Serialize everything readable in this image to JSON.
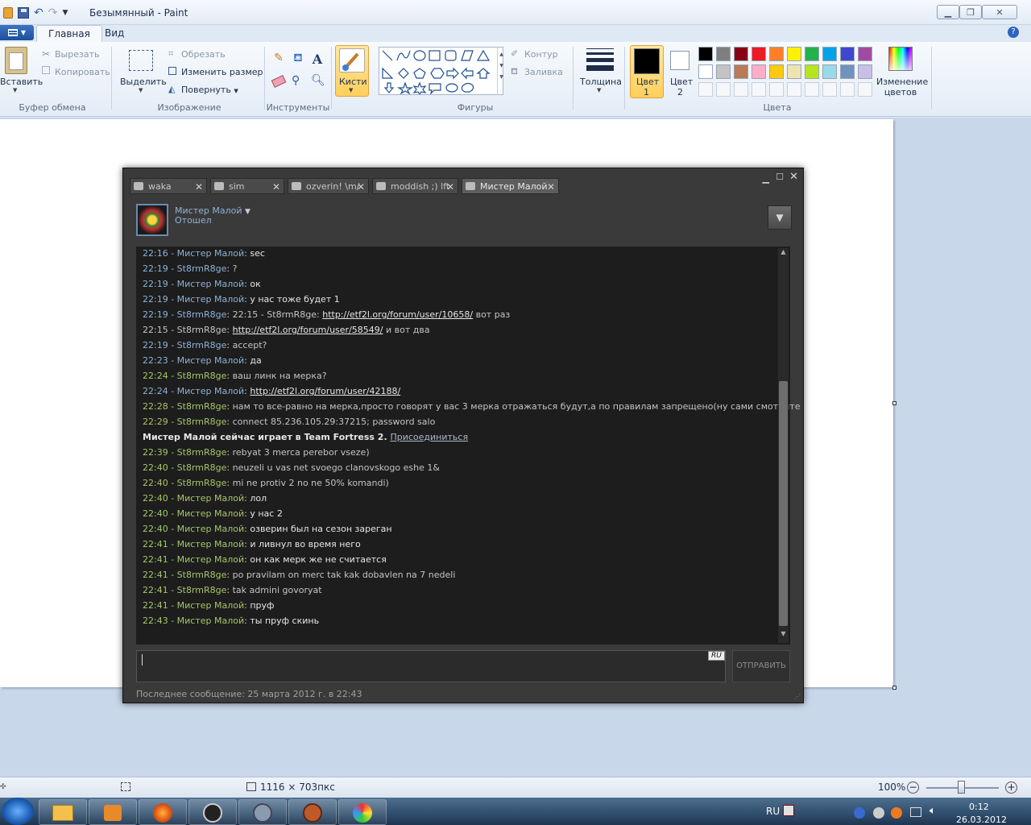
{
  "window": {
    "title": "Безымянный - Paint"
  },
  "ribbon": {
    "tabs": [
      "Главная",
      "Вид"
    ],
    "clipboard": {
      "paste": "Вставить",
      "cut": "Вырезать",
      "copy": "Копировать",
      "group": "Буфер обмена"
    },
    "image": {
      "select": "Выделить",
      "crop": "Обрезать",
      "resize": "Изменить размер",
      "rotate": "Повернуть",
      "group": "Изображение"
    },
    "tools": {
      "group": "Инструменты"
    },
    "brushes": {
      "label": "Кисти"
    },
    "shapes": {
      "outline": "Контур",
      "fill": "Заливка",
      "group": "Фигуры"
    },
    "size": {
      "label": "Толщина"
    },
    "color1": {
      "label1": "Цвет",
      "label2": "1"
    },
    "color2": {
      "label1": "Цвет",
      "label2": "2"
    },
    "colors": {
      "group": "Цвета",
      "edit1": "Изменение",
      "edit2": "цветов",
      "row1": [
        "#000000",
        "#7f7f7f",
        "#880015",
        "#ed1c24",
        "#ff7f27",
        "#fff200",
        "#22b14c",
        "#00a2e8",
        "#3f48cc",
        "#a349a4"
      ],
      "row2": [
        "#ffffff",
        "#c3c3c3",
        "#b97a57",
        "#ffaec9",
        "#ffc90e",
        "#efe4b0",
        "#b5e61d",
        "#99d9ea",
        "#7092be",
        "#c8bfe7"
      ]
    }
  },
  "status": {
    "size": "1116 × 703пкс",
    "zoom": "100%"
  },
  "taskbar": {
    "lang": "RU",
    "time": "0:12",
    "date": "26.03.2012"
  },
  "chat": {
    "tabs": [
      {
        "label": "waka",
        "active": false
      },
      {
        "label": "sim",
        "active": false
      },
      {
        "label": "ozverin! \\m/",
        "active": false
      },
      {
        "label": "moddish ;) lft",
        "active": false
      },
      {
        "label": "Мистер Малой",
        "active": true
      }
    ],
    "friend": {
      "name": "Мистер Малой",
      "status": "Отошел"
    },
    "messages": [
      {
        "time": "22:16",
        "sender": "Мистер Малой",
        "text": "sec",
        "green": false,
        "bright": true
      },
      {
        "time": "22:19",
        "sender": "St8rmR8ge",
        "text": "?",
        "green": false
      },
      {
        "time": "22:19",
        "sender": "Мистер Малой",
        "text": "ок",
        "green": false,
        "bright": true
      },
      {
        "time": "22:19",
        "sender": "Мистер Малой",
        "text": "у нас тоже будет 1",
        "green": false,
        "bright": true
      },
      {
        "time": "22:19",
        "sender": "St8rmR8ge",
        "pre": "22:15 - St8rmR8ge: ",
        "link": "http://etf2l.org/forum/user/10658/",
        "post": " вот раз",
        "green": false
      },
      {
        "time": "",
        "sender": "",
        "pre": "22:15 - St8rmR8ge: ",
        "link": "http://etf2l.org/forum/user/58549/",
        "post": " и вот два",
        "green": false,
        "plain": true
      },
      {
        "time": "22:19",
        "sender": "St8rmR8ge",
        "text": "accept?",
        "green": false
      },
      {
        "time": "22:23",
        "sender": "Мистер Малой",
        "text": "да",
        "green": false,
        "bright": true
      },
      {
        "time": "22:24",
        "sender": "St8rmR8ge",
        "text": "ваш линк на мерка?",
        "green": true
      },
      {
        "time": "22:24",
        "sender": "Мистер Малой",
        "link": "http://etf2l.org/forum/user/42188/",
        "green": false,
        "bright": true
      },
      {
        "time": "22:28",
        "sender": "St8rmR8ge",
        "text": "нам то  все-равно на мерка,просто говорят у вас 3 мерка отражаться будут,а по правилам запрещено(ну сами смотрите",
        "green": true
      },
      {
        "time": "22:29",
        "sender": "St8rmR8ge",
        "text": "connect 85.236.105.29:37215; password salo",
        "green": true
      },
      {
        "ingame": "Мистер Малой сейчас играет в Team Fortress 2.",
        "join": "Присоединиться"
      },
      {
        "time": "22:39",
        "sender": "St8rmR8ge",
        "text": "rebyat 3 merca perebor vseze)",
        "green": true
      },
      {
        "time": "22:40",
        "sender": "St8rmR8ge",
        "text": "neuzeli u vas net svoego clanovskogo eshe 1&",
        "green": true
      },
      {
        "time": "22:40",
        "sender": "St8rmR8ge",
        "text": "mi ne protiv 2 no ne 50% komandi)",
        "green": true
      },
      {
        "time": "22:40",
        "sender": "Мистер Малой",
        "text": "лол",
        "green": true,
        "bright": true
      },
      {
        "time": "22:40",
        "sender": "Мистер Малой",
        "text": "у нас 2",
        "green": true,
        "bright": true
      },
      {
        "time": "22:40",
        "sender": "Мистер Малой",
        "text": "озверин был на сезон зареган",
        "green": true,
        "bright": true
      },
      {
        "time": "22:41",
        "sender": "Мистер Малой",
        "text": "и ливнул во время него",
        "green": true,
        "bright": true
      },
      {
        "time": "22:41",
        "sender": "Мистер Малой",
        "text": "он как мерк же не считается",
        "green": true,
        "bright": true
      },
      {
        "time": "22:41",
        "sender": "St8rmR8ge",
        "text": "po pravilam on merc tak kak dobavlen na 7 nedeli",
        "green": true
      },
      {
        "time": "22:41",
        "sender": "St8rmR8ge",
        "text": "tak admini govoryat",
        "green": true
      },
      {
        "time": "22:41",
        "sender": "Мистер Малой",
        "text": "пруф",
        "green": true,
        "bright": true
      },
      {
        "time": "22:43",
        "sender": "Мистер Малой",
        "text": "ты пруф скинь",
        "green": true,
        "bright": true
      }
    ],
    "input": {
      "lang": "RU",
      "send": "ОТПРАВИТЬ"
    },
    "footer": "Последнее сообщение: 25 марта 2012 г. в 22:43"
  }
}
